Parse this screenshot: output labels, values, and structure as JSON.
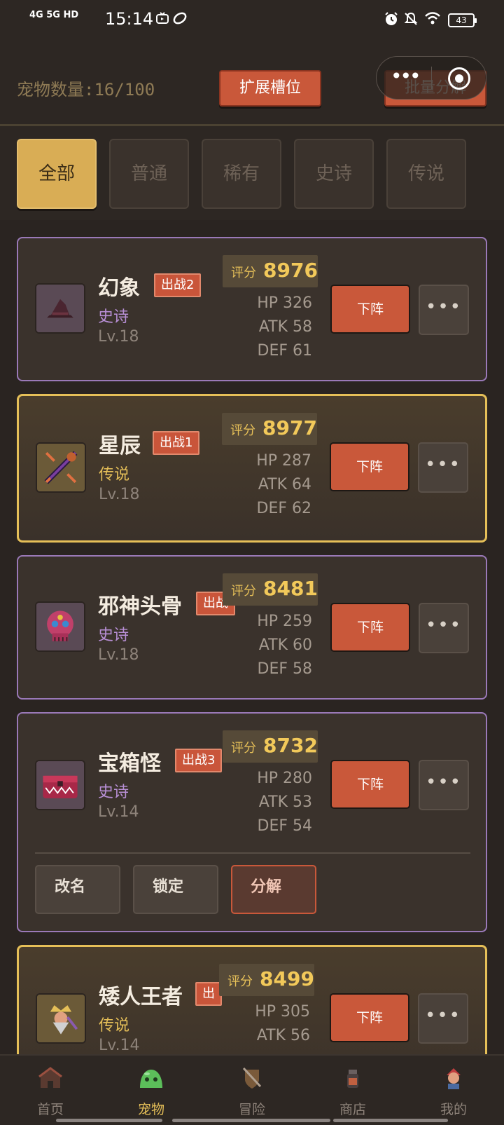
{
  "status_bar": {
    "network": "4G 5G HD",
    "time": "15:14",
    "battery": "43"
  },
  "header": {
    "pet_count": "宠物数量:16/100",
    "expand_button": "扩展槽位",
    "batch_button": "批量分解"
  },
  "filter_tabs": [
    {
      "label": "全部",
      "active": true
    },
    {
      "label": "普通",
      "active": false
    },
    {
      "label": "稀有",
      "active": false
    },
    {
      "label": "史诗",
      "active": false
    },
    {
      "label": "传说",
      "active": false
    }
  ],
  "pets": [
    {
      "name": "幻象",
      "tag": "出战2",
      "rarity": "史诗",
      "level": "Lv.18",
      "score_label": "评分",
      "score": "8976",
      "hp": "HP 326",
      "atk": "ATK 58",
      "def": "DEF 61",
      "action": "下阵",
      "more": "•••"
    },
    {
      "name": "星辰",
      "tag": "出战1",
      "rarity": "传说",
      "level": "Lv.18",
      "score_label": "评分",
      "score": "8977",
      "hp": "HP 287",
      "atk": "ATK 64",
      "def": "DEF 62",
      "action": "下阵",
      "more": "•••"
    },
    {
      "name": "邪神头骨",
      "tag": "出战",
      "rarity": "史诗",
      "level": "Lv.18",
      "score_label": "评分",
      "score": "8481",
      "hp": "HP 259",
      "atk": "ATK 60",
      "def": "DEF 58",
      "action": "下阵",
      "more": "•••"
    },
    {
      "name": "宝箱怪",
      "tag": "出战3",
      "rarity": "史诗",
      "level": "Lv.14",
      "score_label": "评分",
      "score": "8732",
      "hp": "HP 280",
      "atk": "ATK 53",
      "def": "DEF 54",
      "action": "下阵",
      "more": "•••",
      "actions": [
        "改名",
        "锁定",
        "分解"
      ]
    },
    {
      "name": "矮人王者",
      "tag": "出",
      "rarity": "传说",
      "level": "Lv.14",
      "score_label": "评分",
      "score": "8499",
      "hp": "HP 305",
      "atk": "ATK 56",
      "action": "下阵",
      "more": "•••"
    }
  ],
  "bottom_nav": [
    {
      "label": "首页",
      "icon": "house-icon",
      "active": false
    },
    {
      "label": "宠物",
      "icon": "slime-icon",
      "active": true
    },
    {
      "label": "冒险",
      "icon": "shield-sword-icon",
      "active": false
    },
    {
      "label": "商店",
      "icon": "potion-icon",
      "active": false
    },
    {
      "label": "我的",
      "icon": "hero-icon",
      "active": false
    }
  ],
  "colors": {
    "accent_gold": "#e5bf58",
    "action_red": "#c9583a",
    "epic_purple": "#b88fd6",
    "background": "#2c2622"
  }
}
